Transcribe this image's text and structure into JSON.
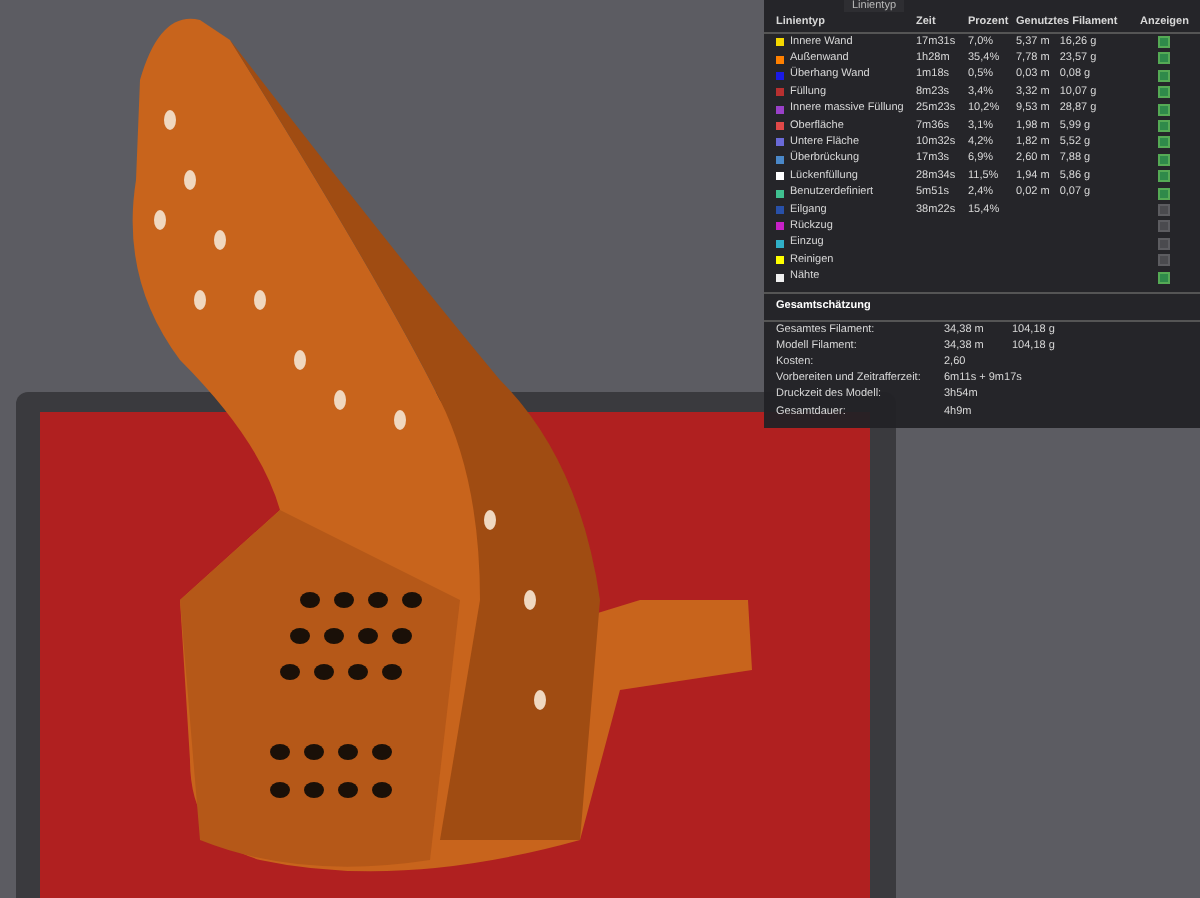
{
  "legend": {
    "dropdown": "Linientyp",
    "columns": [
      "Linientyp",
      "Zeit",
      "Prozent",
      "Genutztes Filament",
      "Anzeigen"
    ],
    "rows": [
      {
        "name": "Innere Wand",
        "color": "#f5d800",
        "time": "17m31s",
        "percent": "7,0%",
        "length": "5,37 m",
        "weight": "16,26 g",
        "checked": true
      },
      {
        "name": "Außenwand",
        "color": "#ff8000",
        "time": "1h28m",
        "percent": "35,4%",
        "length": "7,78 m",
        "weight": "23,57 g",
        "checked": true
      },
      {
        "name": "Überhang Wand",
        "color": "#1a1ae6",
        "time": "1m18s",
        "percent": "0,5%",
        "length": "0,03 m",
        "weight": "0,08 g",
        "checked": true
      },
      {
        "name": "Füllung",
        "color": "#b83030",
        "time": "8m23s",
        "percent": "3,4%",
        "length": "3,32 m",
        "weight": "10,07 g",
        "checked": true
      },
      {
        "name": "Innere massive Füllung",
        "color": "#9a40c8",
        "time": "25m23s",
        "percent": "10,2%",
        "length": "9,53 m",
        "weight": "28,87 g",
        "checked": true
      },
      {
        "name": "Oberfläche",
        "color": "#e04848",
        "time": "7m36s",
        "percent": "3,1%",
        "length": "1,98 m",
        "weight": "5,99 g",
        "checked": true
      },
      {
        "name": "Untere Fläche",
        "color": "#6a6ad8",
        "time": "10m32s",
        "percent": "4,2%",
        "length": "1,82 m",
        "weight": "5,52 g",
        "checked": true
      },
      {
        "name": "Überbrückung",
        "color": "#4a88c8",
        "time": "17m3s",
        "percent": "6,9%",
        "length": "2,60 m",
        "weight": "7,88 g",
        "checked": true
      },
      {
        "name": "Lückenfüllung",
        "color": "#ffffff",
        "time": "28m34s",
        "percent": "11,5%",
        "length": "1,94 m",
        "weight": "5,86 g",
        "checked": true
      },
      {
        "name": "Benutzerdefiniert",
        "color": "#40c090",
        "time": "5m51s",
        "percent": "2,4%",
        "length": "0,02 m",
        "weight": "0,07 g",
        "checked": true
      },
      {
        "name": "Eilgang",
        "color": "#2850a8",
        "time": "38m22s",
        "percent": "15,4%",
        "checked": false
      },
      {
        "name": "Rückzug",
        "color": "#c820c8",
        "checked": false
      },
      {
        "name": "Einzug",
        "color": "#30b0c8",
        "checked": false
      },
      {
        "name": "Reinigen",
        "color": "#ffff00",
        "checked": false
      },
      {
        "name": "Nähte",
        "color": "#f0f0f0",
        "checked": true
      }
    ]
  },
  "summary": {
    "title": "Gesamtschätzung",
    "rows": [
      {
        "label": "Gesamtes Filament:",
        "value": "34,38 m",
        "value_2": "104,18 g"
      },
      {
        "label": "Modell Filament:",
        "value": "34,38 m",
        "value_2": "104,18 g"
      },
      {
        "label": "Kosten:",
        "value": "2,60"
      },
      {
        "label": "Vorbereiten und Zeitrafferzeit:",
        "value": "6m11s + 9m17s"
      },
      {
        "label": "Druckzeit des Modell:",
        "value": "3h54m"
      },
      {
        "label": "Gesamtdauer:",
        "value": "4h9m"
      }
    ]
  }
}
